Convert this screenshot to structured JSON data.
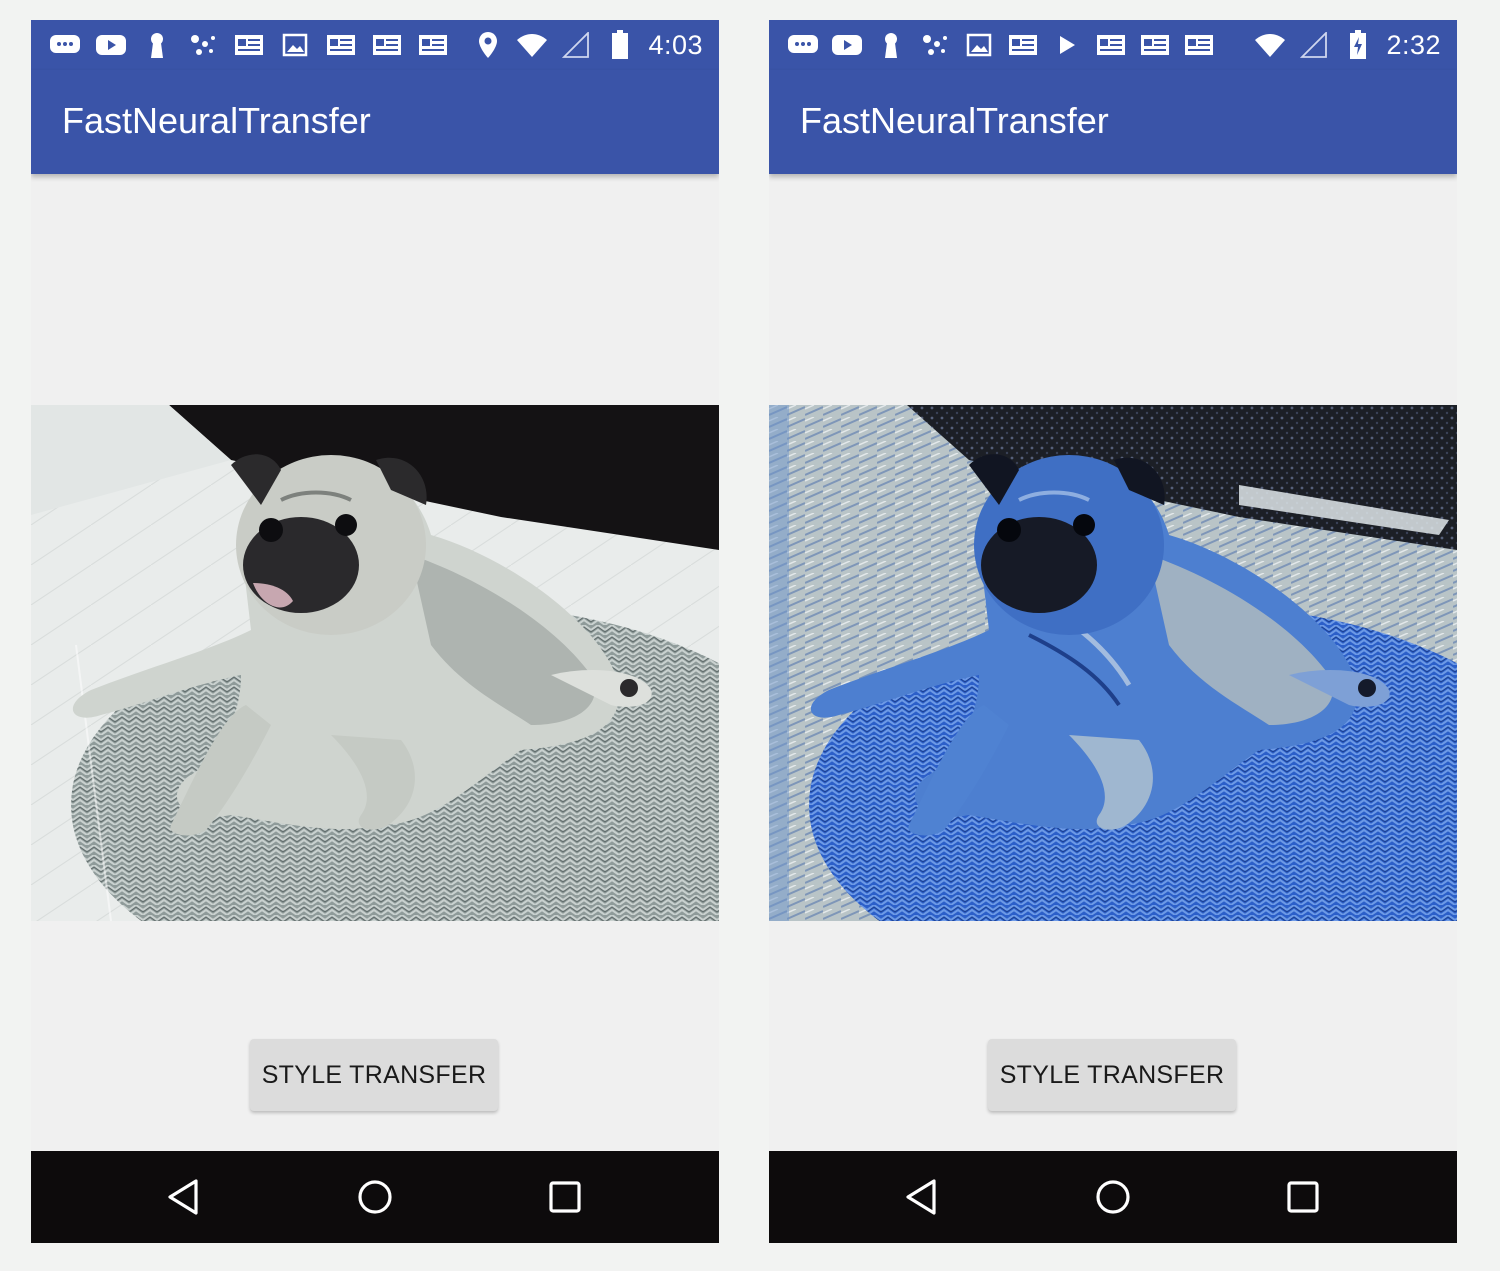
{
  "screens": [
    {
      "status_bar": {
        "time": "4:03",
        "left_icons": [
          "chat-bubble-icon",
          "youtube-icon",
          "keyhole-icon",
          "sync-dots-icon",
          "news-card-icon",
          "image-icon",
          "news-card-icon",
          "news-card-icon",
          "news-card-icon"
        ],
        "right_icons": [
          "location-pin-icon",
          "wifi-icon",
          "cell-signal-icon",
          "battery-icon"
        ]
      },
      "app_title": "FastNeuralTransfer",
      "image": {
        "description": "pug lying on woven rug",
        "style": "original"
      },
      "button_label": "STYLE TRANSFER"
    },
    {
      "status_bar": {
        "time": "2:32",
        "left_icons": [
          "chat-bubble-icon",
          "youtube-icon",
          "keyhole-icon",
          "sync-dots-icon",
          "image-icon",
          "news-card-icon",
          "play-icon",
          "news-card-icon",
          "news-card-icon",
          "news-card-icon"
        ],
        "right_icons": [
          "wifi-icon",
          "cell-signal-icon",
          "battery-charging-icon"
        ]
      },
      "app_title": "FastNeuralTransfer",
      "image": {
        "description": "pug lying on woven rug",
        "style": "stylized"
      },
      "button_label": "STYLE TRANSFER"
    }
  ],
  "colors": {
    "app_bar": "#3a54a8",
    "background": "#f0f0f0",
    "button": "#dcdcdc",
    "nav_bar": "#0d0b0c"
  }
}
